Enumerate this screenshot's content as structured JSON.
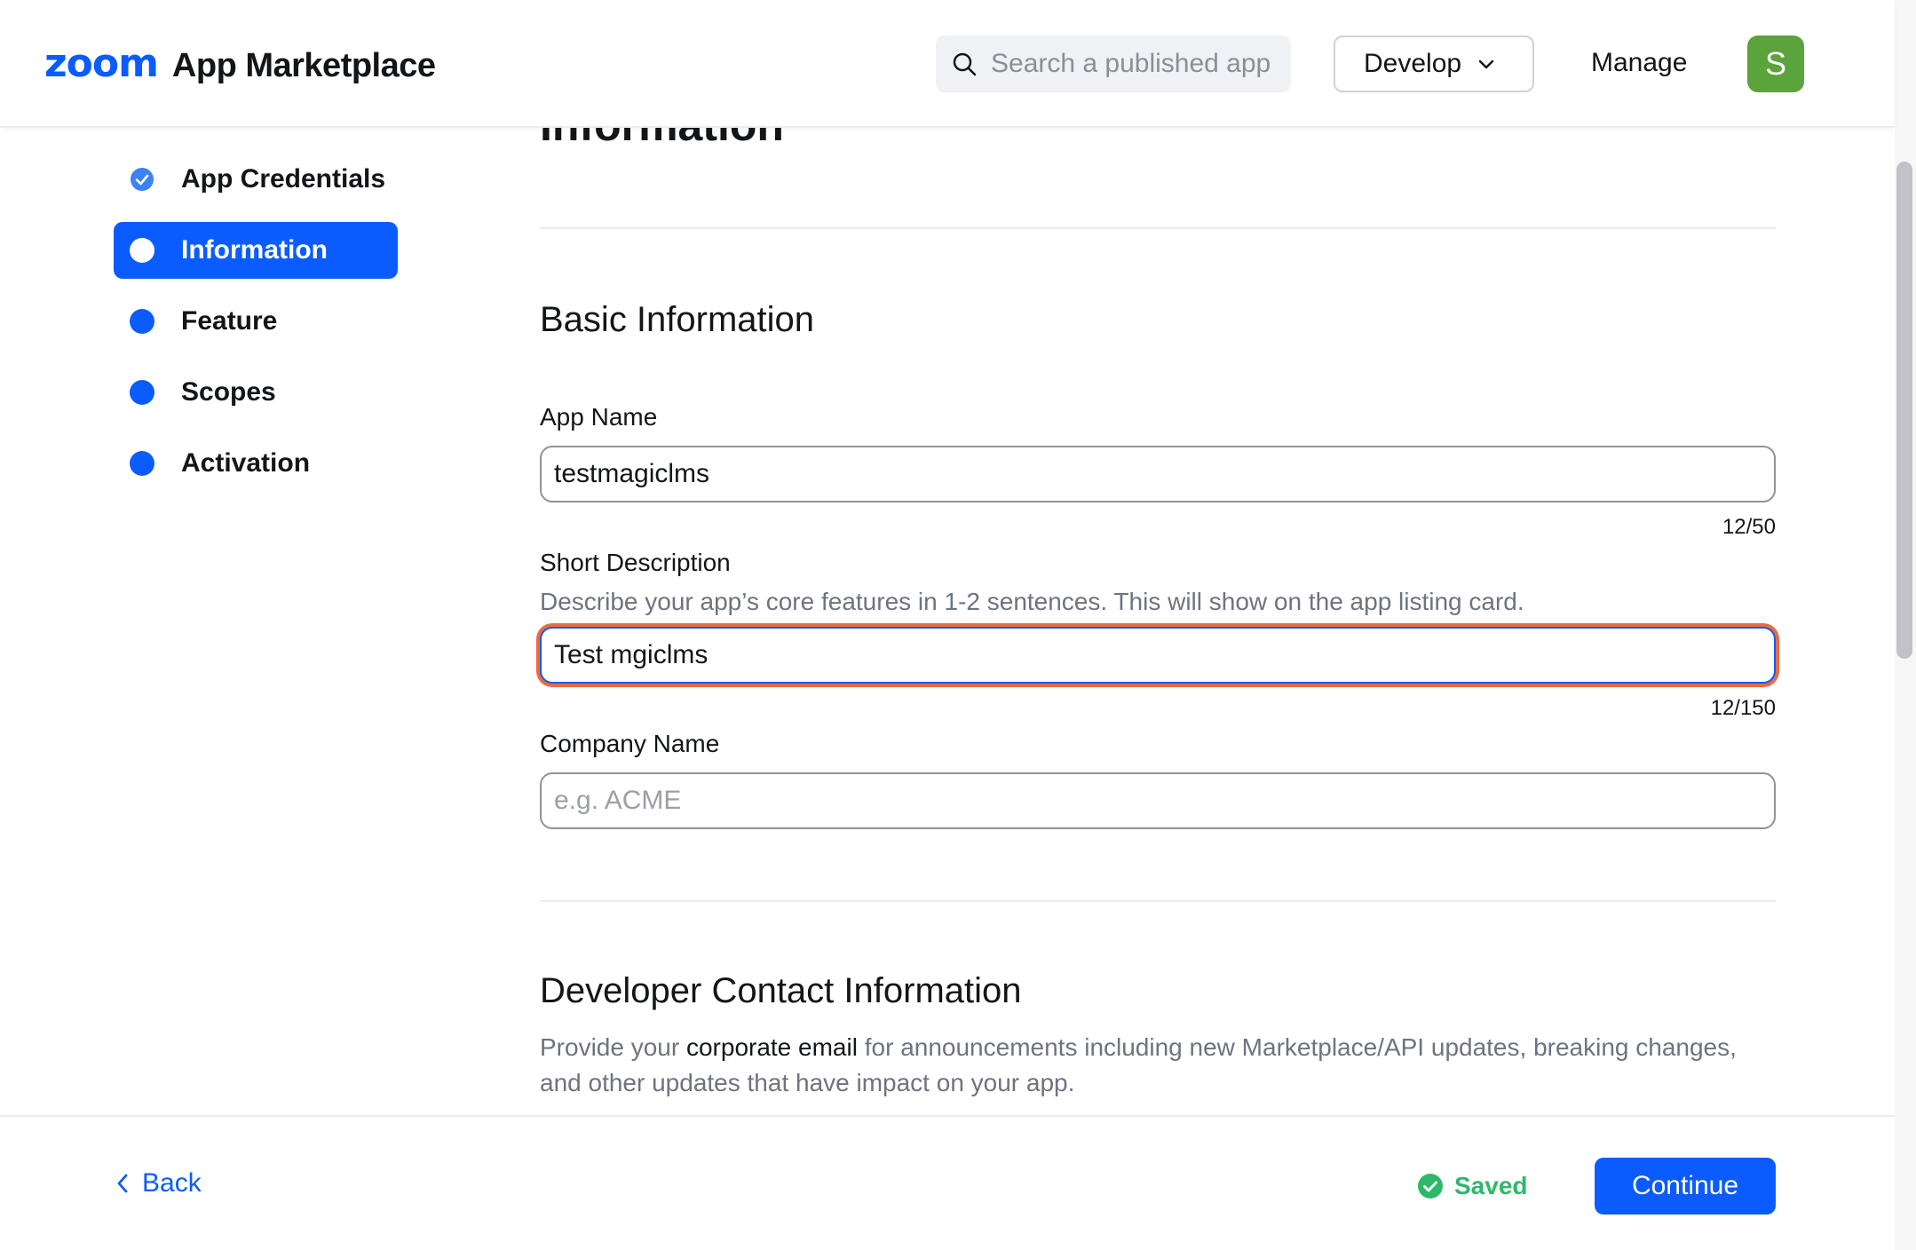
{
  "header": {
    "logo": "zoom",
    "product": "App Marketplace",
    "search_placeholder": "Search a published app",
    "develop_label": "Develop",
    "manage_label": "Manage",
    "avatar_initial": "S",
    "avatar_color": "#5ba33b"
  },
  "sidebar": {
    "items": [
      {
        "label": "App Credentials",
        "state": "completed"
      },
      {
        "label": "Information",
        "state": "active"
      },
      {
        "label": "Feature",
        "state": "pending"
      },
      {
        "label": "Scopes",
        "state": "pending"
      },
      {
        "label": "Activation",
        "state": "pending"
      }
    ]
  },
  "main": {
    "partial_heading": "Information",
    "basic": {
      "title": "Basic Information",
      "app_name": {
        "label": "App Name",
        "value": "testmagiclms",
        "counter": "12/50"
      },
      "short_description": {
        "label": "Short Description",
        "help": "Describe your app’s core features in 1-2 sentences. This will show on the app listing card.",
        "value": "Test mgiclms",
        "counter": "12/150"
      },
      "company_name": {
        "label": "Company Name",
        "value": "",
        "placeholder": "e.g. ACME"
      }
    },
    "contact": {
      "title": "Developer Contact Information",
      "desc_before": "Provide your ",
      "desc_strong": "corporate email",
      "desc_after": " for announcements including new Marketplace/API updates, breaking changes, and other updates that have impact on your app."
    }
  },
  "footer": {
    "back_label": "Back",
    "saved_label": "Saved",
    "continue_label": "Continue"
  },
  "colors": {
    "accent": "#0b5cff",
    "focus_ring": "#ec6a3e",
    "saved": "#2fb86a"
  }
}
